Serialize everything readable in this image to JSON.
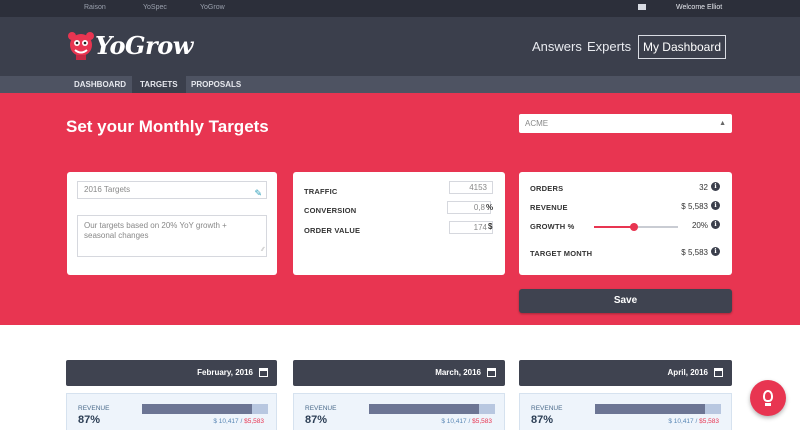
{
  "topbar": {
    "links": [
      "Raison",
      "YoSpec",
      "YoGrow"
    ],
    "welcome": "Welcome Elliot"
  },
  "header": {
    "logo_text": "YoGrow",
    "nav": [
      "Answers",
      "Experts"
    ],
    "dashboard_button": "My Dashboard"
  },
  "subnav": {
    "tabs": [
      "DASHBOARD",
      "TARGETS",
      "PROPOSALS"
    ],
    "active": "TARGETS"
  },
  "hero": {
    "title": "Set your Monthly Targets",
    "company_select": "ACME"
  },
  "targets_card": {
    "name_value": "2016 Targets",
    "note_value": "Our targets based on 20% YoY growth + seasonal changes"
  },
  "inputs_card": {
    "traffic_label": "TRAFFIC",
    "traffic_value": "4153",
    "conversion_label": "CONVERSION",
    "conversion_value": "0,8",
    "conversion_unit": "%",
    "order_value_label": "ORDER VALUE",
    "order_value_value": "174",
    "order_value_unit": "$"
  },
  "results_card": {
    "orders_label": "ORDERS",
    "orders_value": "32",
    "revenue_label": "REVENUE",
    "revenue_value": "$ 5,583",
    "growth_label": "GROWTH %",
    "growth_value": "20%",
    "growth_slider_fraction": 0.48,
    "target_month_label": "TARGET MONTH",
    "target_month_value": "$ 5,583"
  },
  "save_button": "Save",
  "months": [
    {
      "title": "February, 2016",
      "label": "REVENUE",
      "percent": "87%",
      "fill_fraction": 0.87,
      "actual": "$ 10,417",
      "separator": "/",
      "target": "$5,583"
    },
    {
      "title": "March, 2016",
      "label": "REVENUE",
      "percent": "87%",
      "fill_fraction": 0.87,
      "actual": "$ 10,417",
      "separator": "/",
      "target": "$5,583"
    },
    {
      "title": "April, 2016",
      "label": "REVENUE",
      "percent": "87%",
      "fill_fraction": 0.87,
      "actual": "$ 10,417",
      "separator": "/",
      "target": "$5,583"
    }
  ],
  "colors": {
    "brand": "#e83551",
    "header": "#3b3f4c",
    "topbar": "#2c2f3a",
    "accent_blue": "#5a87b5"
  },
  "icons": {
    "mail": "mail-icon",
    "wand": "wand-icon",
    "info": "info-icon",
    "calendar": "calendar-icon",
    "help": "lightbulb-icon",
    "select_arrow": "select-arrows-icon",
    "resize": "resize-grip-icon"
  }
}
